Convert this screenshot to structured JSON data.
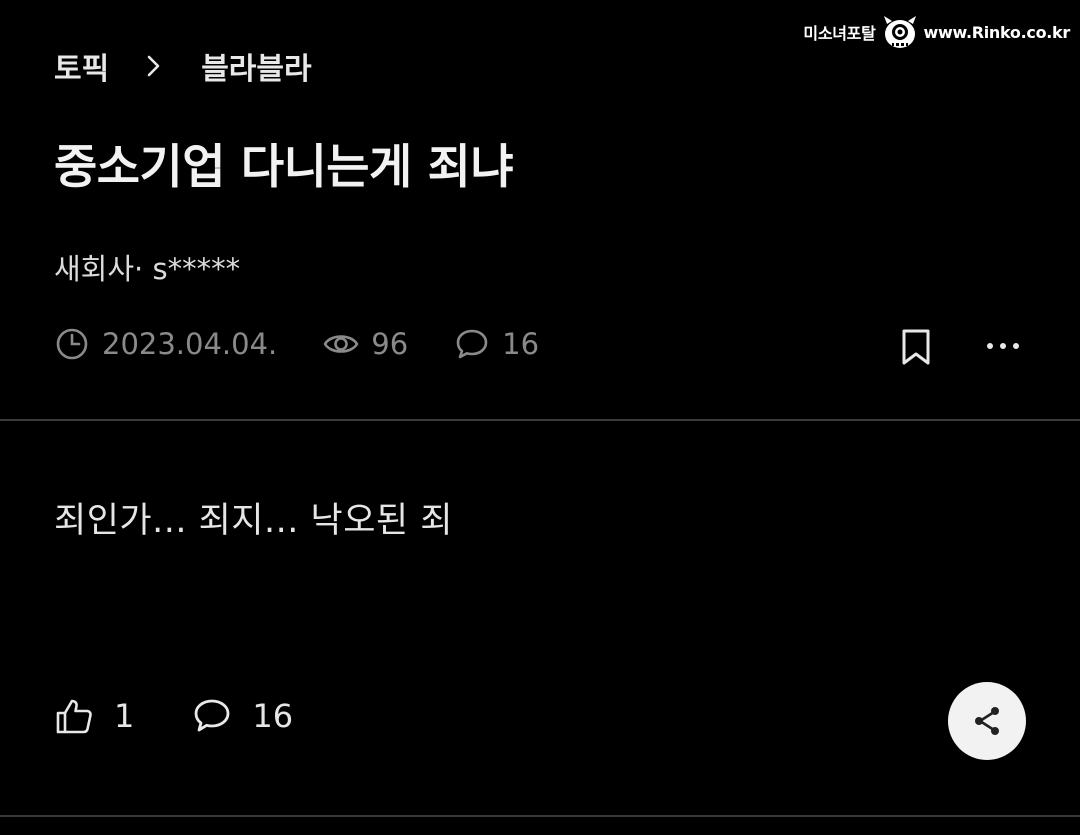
{
  "watermark": {
    "site_name": "미소녀포탈",
    "url": "www.Rinko.co.kr"
  },
  "breadcrumb": {
    "topic": "토픽",
    "board": "블라블라",
    "separator_icon": "chevron-right-icon"
  },
  "post": {
    "title": "중소기업 다니는게 죄냐",
    "author": "새회사· s*****",
    "date": "2023.04.04.",
    "views": "96",
    "comments_count": "16",
    "body": "죄인가... 죄지... 낙오된 죄"
  },
  "actions": {
    "likes": "1",
    "comments": "16"
  },
  "icons": {
    "clock": "clock-icon",
    "views": "eye-icon",
    "comments": "comment-bubble-icon",
    "bookmark": "bookmark-icon",
    "more": "more-dots-icon",
    "like": "thumbs-up-icon",
    "reply": "comment-bubble-icon",
    "share": "share-icon"
  },
  "colors": {
    "background": "#000000",
    "text": "#e8e8e8",
    "muted": "#8a8a8a",
    "divider": "#3a3a3a",
    "share_button_bg": "#f2f2f2"
  }
}
